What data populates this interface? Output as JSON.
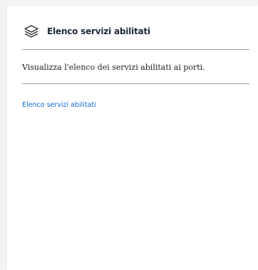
{
  "card": {
    "icon": "layers-icon",
    "title": "Elenco servizi abilitati",
    "description": "Visualizza l'elenco dei servizi abilitati ai porti.",
    "link_label": "Elenco servizi abilitati"
  },
  "colors": {
    "title": "#1e2a3a",
    "link": "#0a6bd1",
    "divider": "#9aa0a6",
    "background": "#f3f3f3",
    "card": "#ffffff"
  }
}
